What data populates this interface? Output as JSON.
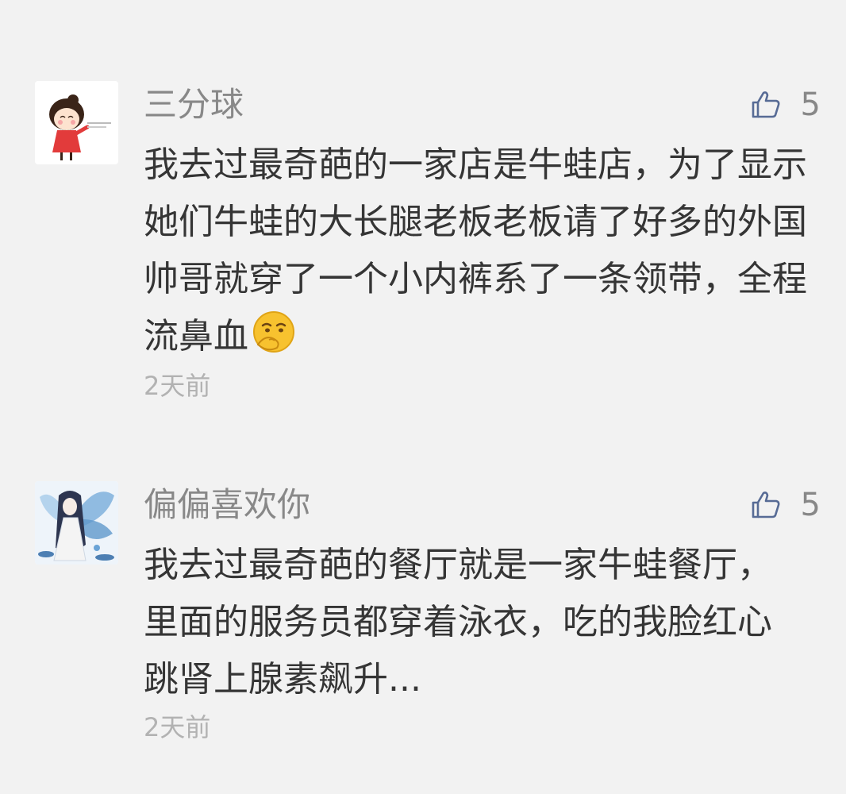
{
  "comments": [
    {
      "author": "三分球",
      "avatar": "cartoon-girl-red-dress-avatar",
      "likes": "5",
      "text": "我去过最奇葩的一家店是牛蛙店，为了显示她们牛蛙的大长腿老板老板请了好多的外国帅哥就穿了一个小内裤系了一条领带，全程流鼻血",
      "emoji": "embarrassed-face-emoji",
      "time": "2天前"
    },
    {
      "author": "偏偏喜欢你",
      "avatar": "anime-fairy-blue-wings-avatar",
      "likes": "5",
      "text": "我去过最奇葩的餐厅就是一家牛蛙餐厅，里面的服务员都穿着泳衣，吃的我脸红心跳肾上腺素飙升...",
      "time": "2天前"
    }
  ],
  "icons": {
    "like": "thumbs-up-icon"
  },
  "colors": {
    "background": "#f2f2f2",
    "author": "#888888",
    "content": "#353535",
    "time": "#b2b2b2",
    "like_icon": "#576b95"
  }
}
